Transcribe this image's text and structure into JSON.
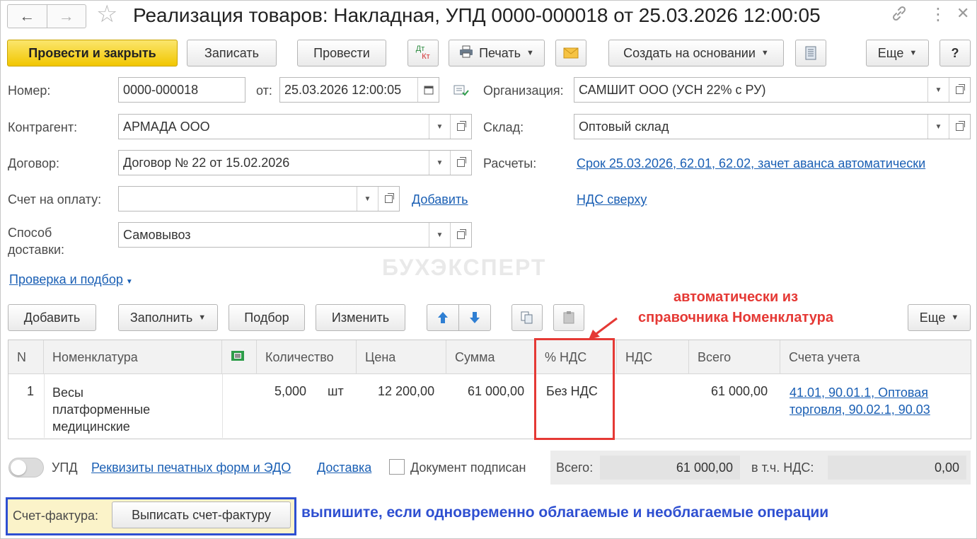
{
  "window": {
    "title": "Реализация товаров: Накладная, УПД 0000-000018 от 25.03.2026 12:00:05",
    "icons": [
      "arrow-left-icon",
      "arrow-right-icon",
      "star-icon",
      "link-icon",
      "more-vertical-icon",
      "close-icon"
    ]
  },
  "toolbar": {
    "post_close": "Провести и закрыть",
    "save": "Записать",
    "post": "Провести",
    "dt_kt_top": "Дт",
    "dt_kt_bottom": "Кт",
    "print": "Печать",
    "create_based": "Создать на основании",
    "more": "Еще",
    "help": "?"
  },
  "form": {
    "number_label": "Номер:",
    "number_value": "0000-000018",
    "from_label": "от:",
    "date_value": "25.03.2026 12:00:05",
    "org_label": "Организация:",
    "org_value": "САМШИТ ООО (УСН 22% с РУ)",
    "counterparty_label": "Контрагент:",
    "counterparty_value": "АРМАДА ООО",
    "warehouse_label": "Склад:",
    "warehouse_value": "Оптовый склад",
    "contract_label": "Договор:",
    "contract_value": "Договор № 22 от 15.02.2026",
    "settlements_label": "Расчеты:",
    "settlements_link": "Срок 25.03.2026, 62.01, 62.02, зачет аванса автоматически",
    "invoice_label": "Счет на оплату:",
    "invoice_value": "",
    "add_link": "Добавить",
    "vat_link": "НДС сверху",
    "delivery_label_1": "Способ",
    "delivery_label_2": "доставки:",
    "delivery_value": "Самовывоз",
    "check_link": "Проверка и подбор"
  },
  "table_toolbar": {
    "add": "Добавить",
    "fill": "Заполнить",
    "pick": "Подбор",
    "change": "Изменить",
    "more": "Еще"
  },
  "table": {
    "headers": {
      "n": "N",
      "nomenclature": "Номенклатура",
      "qty": "Количество",
      "price": "Цена",
      "sum": "Сумма",
      "vat_rate": "% НДС",
      "vat": "НДС",
      "total": "Всего",
      "accounts": "Счета учета"
    },
    "rows": [
      {
        "n": "1",
        "name_1": "Весы",
        "name_2": "платформенные",
        "name_3": "медицинские",
        "qty": "5,000",
        "unit": "шт",
        "price": "12 200,00",
        "sum": "61 000,00",
        "vat_rate": "Без НДС",
        "vat": "",
        "total": "61 000,00",
        "accounts_1": "41.01, 90.01.1, Оптовая",
        "accounts_2": "торговля, 90.02.1, 90.03"
      }
    ]
  },
  "footer": {
    "upd_label": "УПД",
    "requisites_link": "Реквизиты печатных форм и ЭДО",
    "delivery_link": "Доставка",
    "signed_label": "Документ подписан",
    "total_label": "Всего:",
    "total_value": "61 000,00",
    "vat_incl_label": "в т.ч. НДС:",
    "vat_incl_value": "0,00",
    "invoice_label": "Счет-фактура:",
    "invoice_button": "Выписать счет-фактуру"
  },
  "annotations": {
    "red_line_1": "автоматически из",
    "red_line_2": "справочника Номенклатура",
    "blue_note": "выпишите, если одновременно облагаемые и необлагаемые операции"
  },
  "watermark": "БУХЭКСПЕРТ",
  "colors": {
    "primary_button": "#f5cf1a",
    "link": "#1a5fb4",
    "annotation_red": "#e53935",
    "annotation_blue": "#2e4fd1"
  }
}
